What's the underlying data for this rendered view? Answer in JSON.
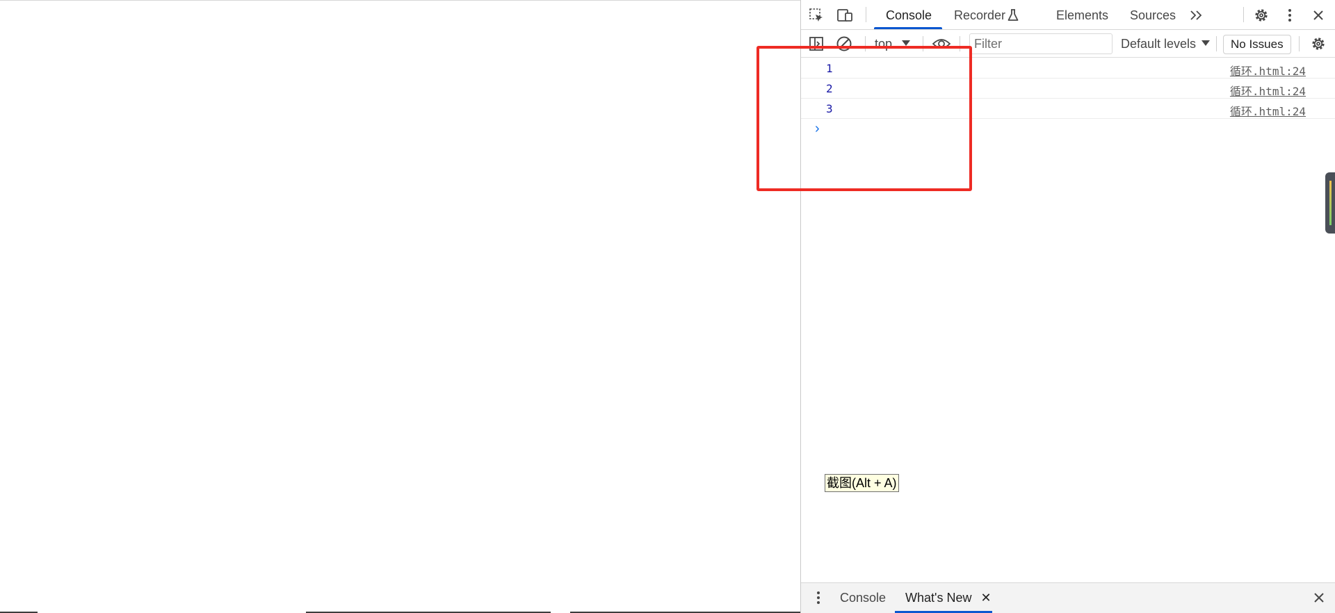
{
  "devtools": {
    "tabs": [
      {
        "label": "Console",
        "active": true
      },
      {
        "label": "Recorder"
      },
      {
        "label": "Elements"
      },
      {
        "label": "Sources"
      }
    ],
    "icons": {
      "inspect": "inspect-element-icon",
      "device": "device-toolbar-icon",
      "recorder": "flask-icon",
      "more_tabs": "chevron-double-right-icon",
      "settings": "gear-icon",
      "menu": "kebab-menu-icon",
      "close": "close-icon"
    }
  },
  "console_toolbar": {
    "context": "top",
    "filter_placeholder": "Filter",
    "levels_label": "Default levels",
    "issues_label": "No Issues",
    "icons": {
      "sidebar": "sidebar-toggle-icon",
      "clear": "clear-console-icon",
      "live_expression": "eye-icon",
      "settings": "gear-icon"
    }
  },
  "console_messages": [
    {
      "value": "1",
      "source": "循环.html:24"
    },
    {
      "value": "2",
      "source": "循环.html:24"
    },
    {
      "value": "3",
      "source": "循环.html:24"
    }
  ],
  "prompt_symbol": "›",
  "tooltip": "截图(Alt + A)",
  "drawer": {
    "tabs": [
      {
        "label": "Console"
      },
      {
        "label": "What's New",
        "active": true
      }
    ],
    "close_tab_symbol": "✕"
  },
  "colors": {
    "accent": "#0b57d0",
    "console_number": "#1a1aa6",
    "annotation": "#ee2b24"
  }
}
